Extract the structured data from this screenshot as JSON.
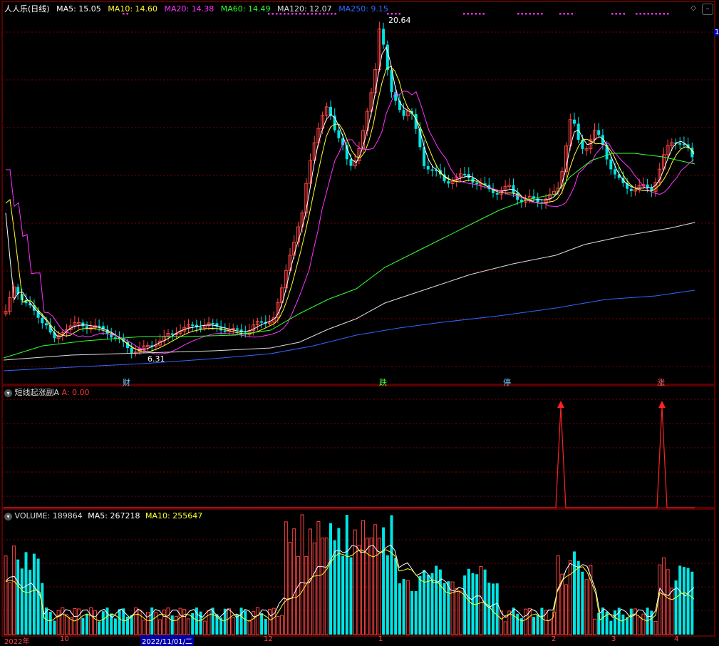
{
  "main": {
    "title": "人人乐(日线)",
    "ma": [
      {
        "label": "MA5: 15.05",
        "color": "#ffffff"
      },
      {
        "label": "MA10: 14.60",
        "color": "#ffff33"
      },
      {
        "label": "MA20: 14.38",
        "color": "#ff33ff"
      },
      {
        "label": "MA60: 14.49",
        "color": "#33ff33"
      },
      {
        "label": "MA120: 12.07",
        "color": "#dddddd"
      },
      {
        "label": "MA250: 9.15",
        "color": "#3366ff"
      }
    ],
    "high_label": "20.64",
    "low_label": "6.31",
    "right_tag": "1",
    "markers": [
      {
        "text": "财",
        "color": "#66ccff"
      },
      {
        "text": "跌",
        "color": "#33ff33"
      },
      {
        "text": "停",
        "color": "#66ccff"
      },
      {
        "text": "涨",
        "color": "#ff6666"
      }
    ]
  },
  "indicator": {
    "name": "短线起涨副A",
    "value": "A: 0.00",
    "value_color": "#ff3333"
  },
  "volume": {
    "label": "VOLUME: 189864",
    "ma5": "MA5: 267218",
    "ma10": "MA10: 255647"
  },
  "date_axis": [
    "2022年",
    "10",
    "2022/11/01/二",
    "12",
    "1",
    "2",
    "3",
    "4"
  ],
  "colors": {
    "up": "#ff4444",
    "down": "#00e5e5",
    "grid": "#800000",
    "frame": "#b00000"
  }
}
